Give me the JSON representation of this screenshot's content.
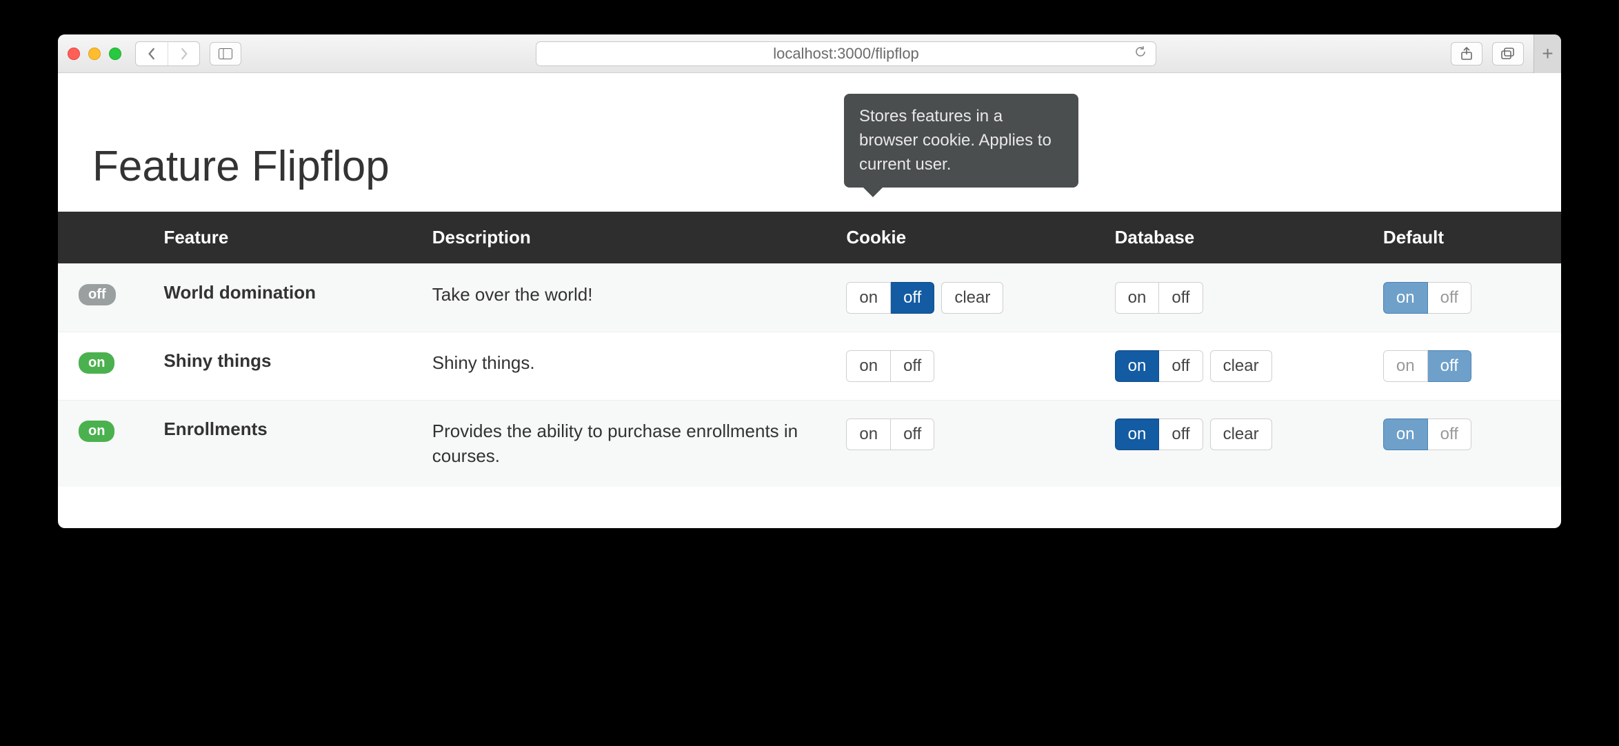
{
  "browser": {
    "url": "localhost:3000/flipflop"
  },
  "page": {
    "title": "Feature Flipflop"
  },
  "tooltip": {
    "text": "Stores features in a browser cookie. Applies to current user."
  },
  "table": {
    "headers": {
      "feature": "Feature",
      "description": "Description",
      "cookie": "Cookie",
      "database": "Database",
      "default": "Default"
    },
    "buttons": {
      "on": "on",
      "off": "off",
      "clear": "clear"
    },
    "rows": [
      {
        "status": "off",
        "name": "World domination",
        "description": "Take over the world!",
        "cookie": {
          "on": false,
          "off": true,
          "clear": true,
          "active": "off"
        },
        "database": {
          "on": false,
          "off": false,
          "clear": false,
          "active": null
        },
        "default": {
          "active": "on"
        }
      },
      {
        "status": "on",
        "name": "Shiny things",
        "description": "Shiny things.",
        "cookie": {
          "on": false,
          "off": false,
          "clear": false,
          "active": null
        },
        "database": {
          "on": true,
          "off": false,
          "clear": true,
          "active": "on"
        },
        "default": {
          "active": "off"
        }
      },
      {
        "status": "on",
        "name": "Enrollments",
        "description": "Provides the ability to purchase enrollments in courses.",
        "cookie": {
          "on": false,
          "off": false,
          "clear": false,
          "active": null
        },
        "database": {
          "on": true,
          "off": false,
          "clear": true,
          "active": "on"
        },
        "default": {
          "active": "on"
        }
      }
    ]
  }
}
